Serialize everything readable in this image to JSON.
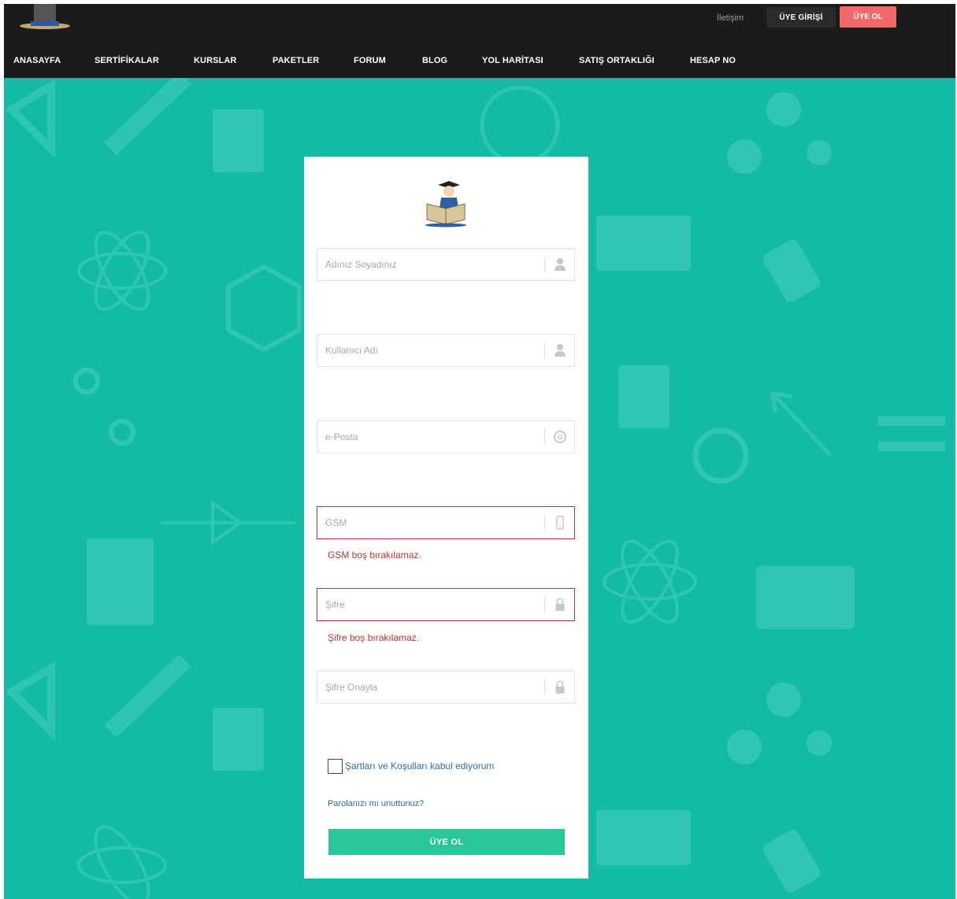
{
  "header": {
    "contact_label": "İletişim",
    "login_label": "ÜYE GİRİŞİ",
    "register_label": "ÜYE OL"
  },
  "nav": {
    "items": [
      {
        "label": "ANASAYFA"
      },
      {
        "label": "SERTİFİKALAR"
      },
      {
        "label": "KURSLAR"
      },
      {
        "label": "PAKETLER"
      },
      {
        "label": "FORUM"
      },
      {
        "label": "BLOG"
      },
      {
        "label": "YOL HARİTASI"
      },
      {
        "label": "SATIŞ ORTAKLIĞI"
      },
      {
        "label": "HESAP NO"
      }
    ]
  },
  "form": {
    "fields": [
      {
        "placeholder": "Adınız Soyadınız",
        "value": "",
        "icon": "user-icon"
      },
      {
        "placeholder": "Kullanıcı Adı",
        "value": "",
        "icon": "user-icon"
      },
      {
        "placeholder": "e-Posta",
        "value": "",
        "icon": "at-icon"
      },
      {
        "placeholder": "GSM",
        "value": "",
        "icon": "mobile-icon",
        "error": "GSM boş bırakılamaz."
      },
      {
        "placeholder": "Şifre",
        "value": "",
        "icon": "lock-icon",
        "error": "Şifre boş bırakılamaz."
      },
      {
        "placeholder": "Şifre Onayla",
        "value": "",
        "icon": "lock-icon"
      }
    ],
    "terms_label": "Şartları ve Koşulları kabul ediyorum",
    "terms_checked": false,
    "forgot_label": "Parolanızı mı unuttunuz?",
    "submit_label": "ÜYE OL"
  },
  "colors": {
    "background": "#13bba4",
    "header": "#1b1b1b",
    "register_button": "#f06a6a",
    "submit_button": "#2bc79b",
    "error": "#b9373a",
    "link": "#2f6ea6"
  }
}
